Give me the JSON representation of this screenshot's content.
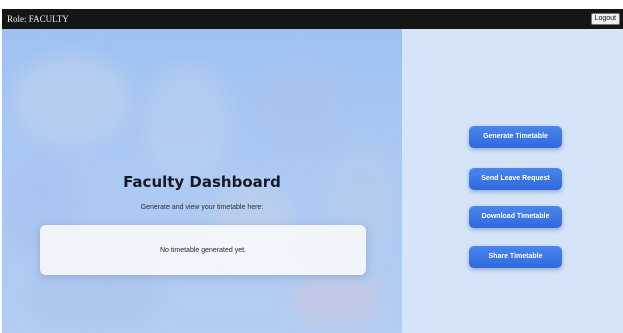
{
  "header": {
    "role_label": "Role: FACULTY",
    "logout_label": "Logout"
  },
  "dashboard": {
    "title": "Faculty Dashboard",
    "subtitle": "Generate and view your timetable here:",
    "empty_message": "No timetable generated yet."
  },
  "actions": {
    "generate_label": "Generate Timetable",
    "leave_label": "Send Leave Request",
    "download_label": "Download Timetable",
    "share_label": "Share Timetable"
  },
  "colors": {
    "topbar": "#151515",
    "left_panel": "#abc9f3",
    "right_panel": "#d5e4f9",
    "button": "#3a74e6",
    "button_text": "#ffffff"
  }
}
